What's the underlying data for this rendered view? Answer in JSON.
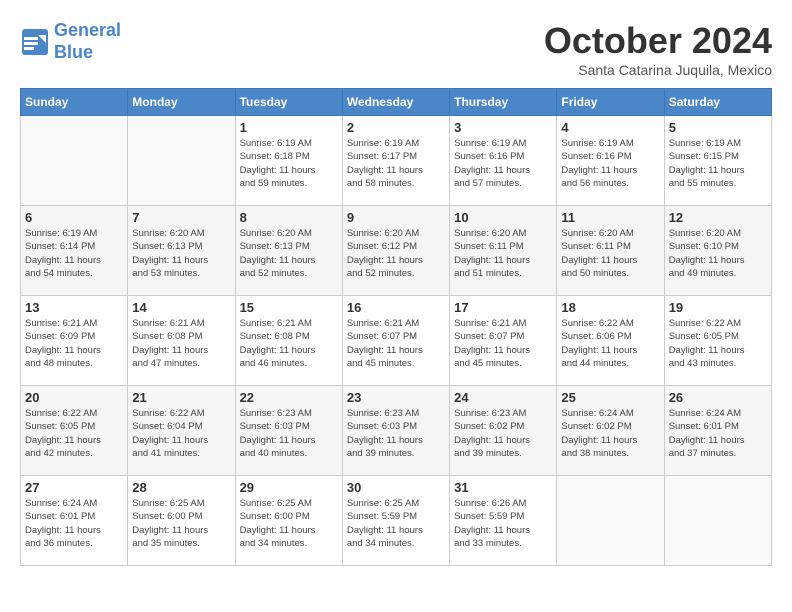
{
  "header": {
    "logo_line1": "General",
    "logo_line2": "Blue",
    "month": "October 2024",
    "location": "Santa Catarina Juquila, Mexico"
  },
  "weekdays": [
    "Sunday",
    "Monday",
    "Tuesday",
    "Wednesday",
    "Thursday",
    "Friday",
    "Saturday"
  ],
  "weeks": [
    [
      {
        "day": "",
        "info": ""
      },
      {
        "day": "",
        "info": ""
      },
      {
        "day": "1",
        "info": "Sunrise: 6:19 AM\nSunset: 6:18 PM\nDaylight: 11 hours\nand 59 minutes."
      },
      {
        "day": "2",
        "info": "Sunrise: 6:19 AM\nSunset: 6:17 PM\nDaylight: 11 hours\nand 58 minutes."
      },
      {
        "day": "3",
        "info": "Sunrise: 6:19 AM\nSunset: 6:16 PM\nDaylight: 11 hours\nand 57 minutes."
      },
      {
        "day": "4",
        "info": "Sunrise: 6:19 AM\nSunset: 6:16 PM\nDaylight: 11 hours\nand 56 minutes."
      },
      {
        "day": "5",
        "info": "Sunrise: 6:19 AM\nSunset: 6:15 PM\nDaylight: 11 hours\nand 55 minutes."
      }
    ],
    [
      {
        "day": "6",
        "info": "Sunrise: 6:19 AM\nSunset: 6:14 PM\nDaylight: 11 hours\nand 54 minutes."
      },
      {
        "day": "7",
        "info": "Sunrise: 6:20 AM\nSunset: 6:13 PM\nDaylight: 11 hours\nand 53 minutes."
      },
      {
        "day": "8",
        "info": "Sunrise: 6:20 AM\nSunset: 6:13 PM\nDaylight: 11 hours\nand 52 minutes."
      },
      {
        "day": "9",
        "info": "Sunrise: 6:20 AM\nSunset: 6:12 PM\nDaylight: 11 hours\nand 52 minutes."
      },
      {
        "day": "10",
        "info": "Sunrise: 6:20 AM\nSunset: 6:11 PM\nDaylight: 11 hours\nand 51 minutes."
      },
      {
        "day": "11",
        "info": "Sunrise: 6:20 AM\nSunset: 6:11 PM\nDaylight: 11 hours\nand 50 minutes."
      },
      {
        "day": "12",
        "info": "Sunrise: 6:20 AM\nSunset: 6:10 PM\nDaylight: 11 hours\nand 49 minutes."
      }
    ],
    [
      {
        "day": "13",
        "info": "Sunrise: 6:21 AM\nSunset: 6:09 PM\nDaylight: 11 hours\nand 48 minutes."
      },
      {
        "day": "14",
        "info": "Sunrise: 6:21 AM\nSunset: 6:08 PM\nDaylight: 11 hours\nand 47 minutes."
      },
      {
        "day": "15",
        "info": "Sunrise: 6:21 AM\nSunset: 6:08 PM\nDaylight: 11 hours\nand 46 minutes."
      },
      {
        "day": "16",
        "info": "Sunrise: 6:21 AM\nSunset: 6:07 PM\nDaylight: 11 hours\nand 45 minutes."
      },
      {
        "day": "17",
        "info": "Sunrise: 6:21 AM\nSunset: 6:07 PM\nDaylight: 11 hours\nand 45 minutes."
      },
      {
        "day": "18",
        "info": "Sunrise: 6:22 AM\nSunset: 6:06 PM\nDaylight: 11 hours\nand 44 minutes."
      },
      {
        "day": "19",
        "info": "Sunrise: 6:22 AM\nSunset: 6:05 PM\nDaylight: 11 hours\nand 43 minutes."
      }
    ],
    [
      {
        "day": "20",
        "info": "Sunrise: 6:22 AM\nSunset: 6:05 PM\nDaylight: 11 hours\nand 42 minutes."
      },
      {
        "day": "21",
        "info": "Sunrise: 6:22 AM\nSunset: 6:04 PM\nDaylight: 11 hours\nand 41 minutes."
      },
      {
        "day": "22",
        "info": "Sunrise: 6:23 AM\nSunset: 6:03 PM\nDaylight: 11 hours\nand 40 minutes."
      },
      {
        "day": "23",
        "info": "Sunrise: 6:23 AM\nSunset: 6:03 PM\nDaylight: 11 hours\nand 39 minutes."
      },
      {
        "day": "24",
        "info": "Sunrise: 6:23 AM\nSunset: 6:02 PM\nDaylight: 11 hours\nand 39 minutes."
      },
      {
        "day": "25",
        "info": "Sunrise: 6:24 AM\nSunset: 6:02 PM\nDaylight: 11 hours\nand 38 minutes."
      },
      {
        "day": "26",
        "info": "Sunrise: 6:24 AM\nSunset: 6:01 PM\nDaylight: 11 hours\nand 37 minutes."
      }
    ],
    [
      {
        "day": "27",
        "info": "Sunrise: 6:24 AM\nSunset: 6:01 PM\nDaylight: 11 hours\nand 36 minutes."
      },
      {
        "day": "28",
        "info": "Sunrise: 6:25 AM\nSunset: 6:00 PM\nDaylight: 11 hours\nand 35 minutes."
      },
      {
        "day": "29",
        "info": "Sunrise: 6:25 AM\nSunset: 6:00 PM\nDaylight: 11 hours\nand 34 minutes."
      },
      {
        "day": "30",
        "info": "Sunrise: 6:25 AM\nSunset: 5:59 PM\nDaylight: 11 hours\nand 34 minutes."
      },
      {
        "day": "31",
        "info": "Sunrise: 6:26 AM\nSunset: 5:59 PM\nDaylight: 11 hours\nand 33 minutes."
      },
      {
        "day": "",
        "info": ""
      },
      {
        "day": "",
        "info": ""
      }
    ]
  ]
}
